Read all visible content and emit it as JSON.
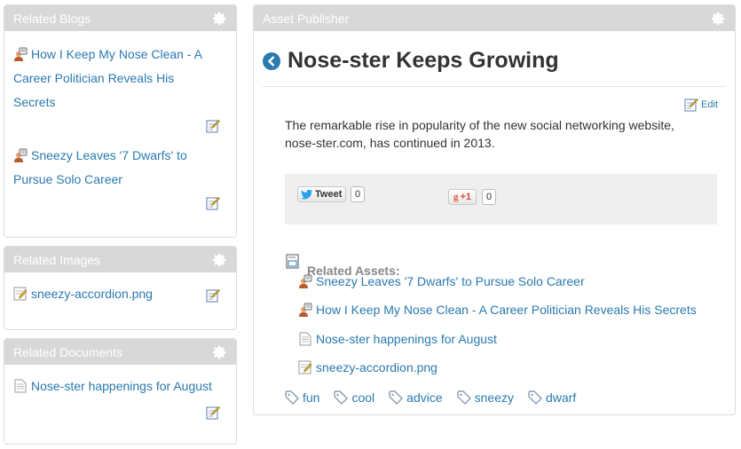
{
  "related_blogs": {
    "title": "Related Blogs",
    "entries": [
      {
        "line1": "How I Keep My Nose Clean - A",
        "line2": "Career Politician Reveals His",
        "line3": "Secrets"
      },
      {
        "line1": "Sneezy Leaves '7 Dwarfs' to",
        "line2": "Pursue Solo Career"
      }
    ]
  },
  "related_images": {
    "title": "Related Images",
    "items": [
      "sneezy-accordion.png"
    ]
  },
  "related_documents": {
    "title": "Related Documents",
    "items": [
      "Nose-ster happenings for August"
    ]
  },
  "asset_publisher": {
    "title": "Asset Publisher",
    "asset_title": "Nose-ster Keeps Growing",
    "edit_label": "Edit",
    "body_line1": "The remarkable rise in popularity of the new social networking website,",
    "body_line2": "nose-ster.com, has continued in 2013.",
    "tweet_label": "Tweet",
    "tweet_count": "0",
    "gplus_label": "+1",
    "gplus_count": "0",
    "related_assets_label": "Related Assets:",
    "related_assets": [
      "Sneezy Leaves '7 Dwarfs' to Pursue Solo Career",
      "How I Keep My Nose Clean - A Career Politician Reveals His Secrets",
      "Nose-ster happenings for August",
      "sneezy-accordion.png"
    ],
    "tags": [
      "fun",
      "cool",
      "advice",
      "sneezy",
      "dwarf"
    ]
  },
  "colors": {
    "link": "#2a7ab0",
    "header_bg": "#d8d8d8",
    "social_bg": "#efefef"
  }
}
